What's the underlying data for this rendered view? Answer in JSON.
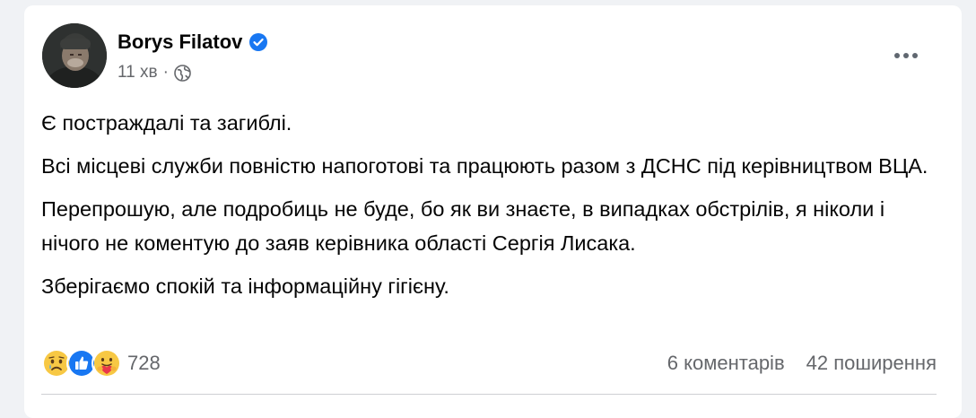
{
  "post": {
    "author": "Borys Filatov",
    "time": "11 хв",
    "dot": "·",
    "paragraphs": [
      "Є постраждалі та загиблі.",
      "Всі місцеві служби повністю напоготові та працюють разом з ДСНС під керівництвом ВЦА.",
      "Перепрошую, але подробиць не буде, бо як ви знаєте, в випадках обстрілів, я ніколи і нічого не коментую до заяв керівника області Сергія Лисака.",
      "Зберігаємо спокій та інформаційну гігієну."
    ],
    "reaction_icons": [
      "sad-icon",
      "like-icon",
      "care-icon"
    ],
    "reaction_count": "728",
    "comments": "6 коментарів",
    "shares": "42 поширення"
  },
  "colors": {
    "background": "#f0f2f5",
    "card": "#ffffff",
    "text": "#050505",
    "secondary_text": "#65676b",
    "verified": "#1877f2",
    "like": "#1877f2"
  }
}
